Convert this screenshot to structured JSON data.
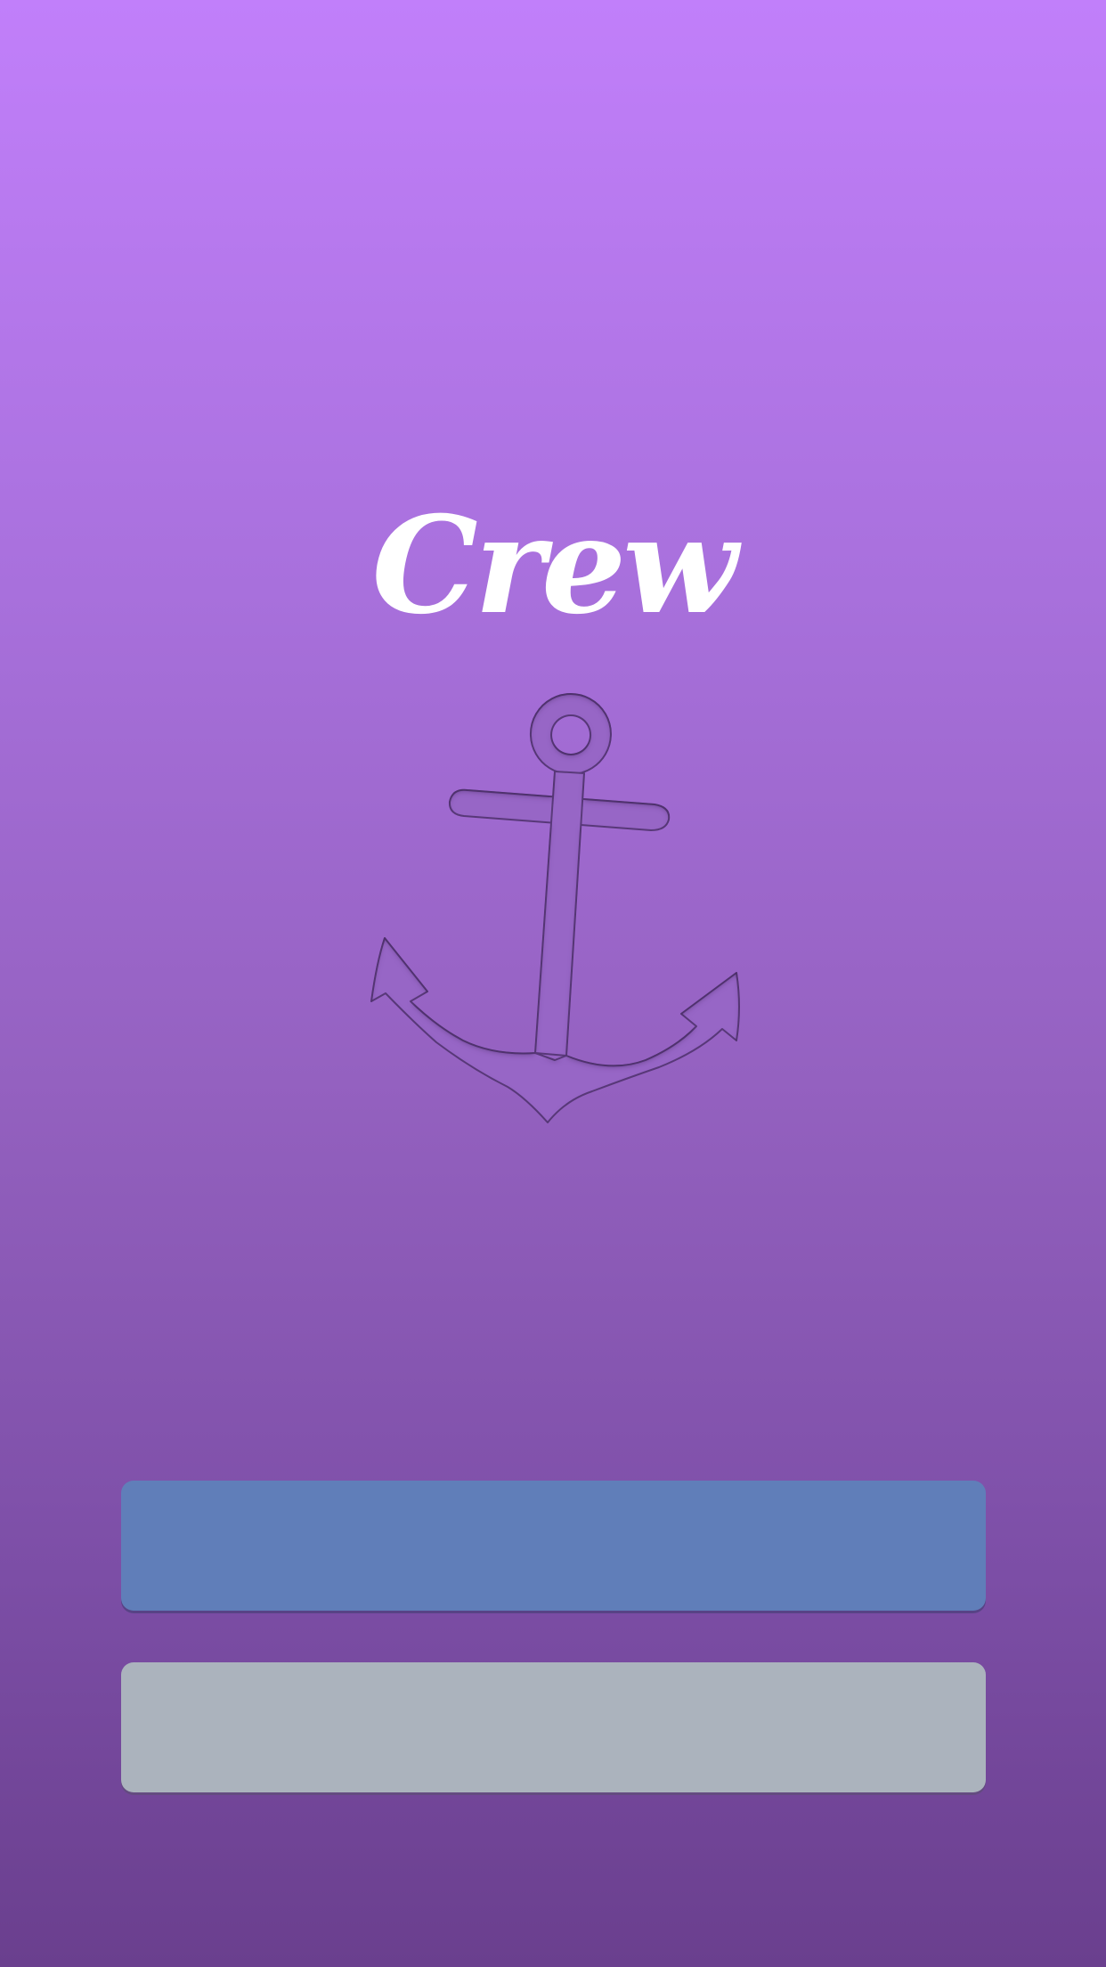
{
  "app": {
    "title": "Crew"
  },
  "theme": {
    "gradient_top": "#c17ffa",
    "gradient_bottom": "#6a3f8e",
    "primary_button_color": "#607eb9",
    "secondary_button_color": "#abb3bd",
    "title_color": "#ffffff"
  },
  "icons": {
    "logo": "anchor-icon"
  },
  "buttons": {
    "primary_label": "",
    "secondary_label": ""
  }
}
